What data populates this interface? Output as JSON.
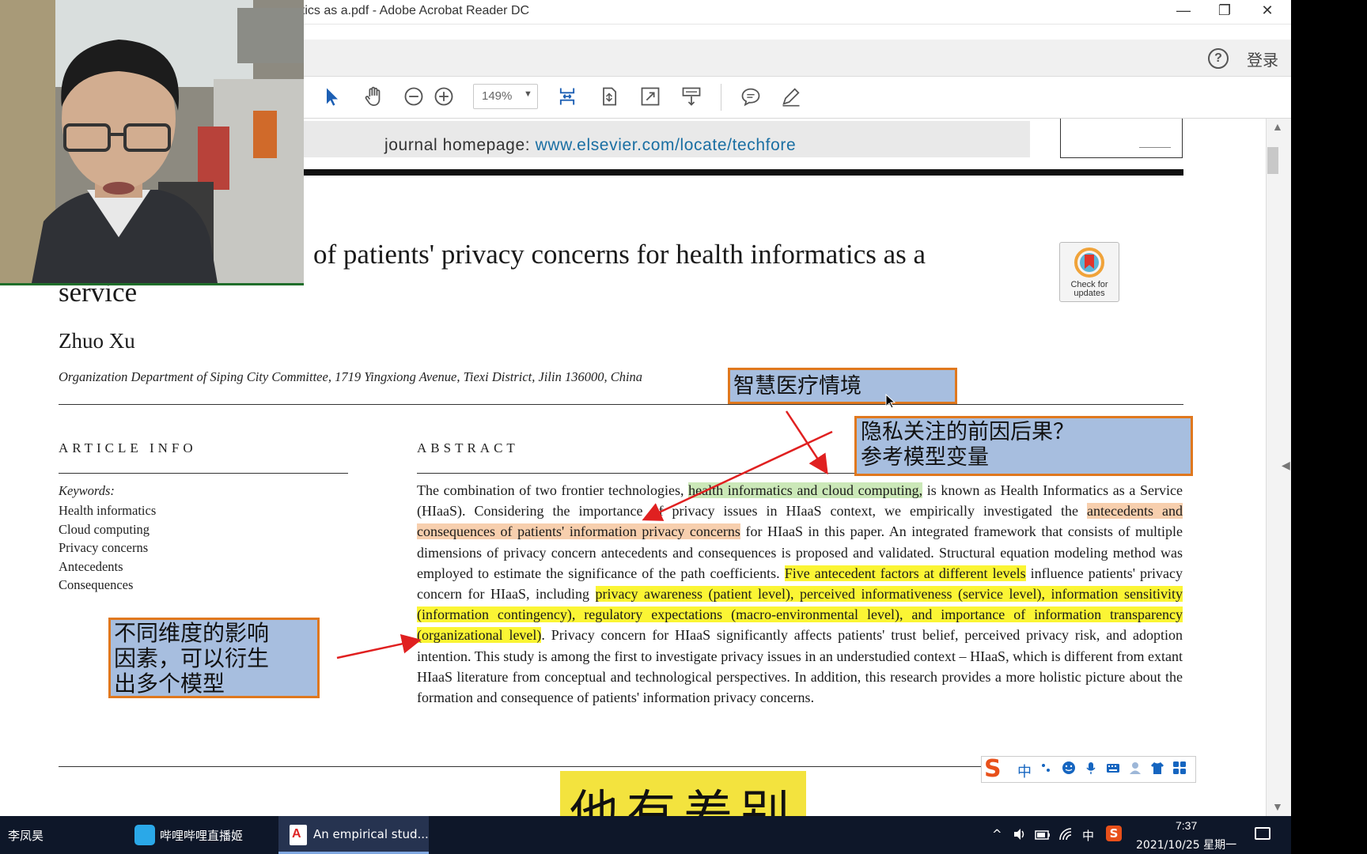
{
  "window": {
    "title": "atics as a.pdf - Adobe Acrobat Reader DC",
    "minimize_icon": "—",
    "restore_icon": "❐",
    "close_icon": "✕"
  },
  "menubar": {
    "help_icon": "?",
    "login_label": "登录"
  },
  "toolbar": {
    "zoom_value": "149%",
    "zoom_caret": "▼"
  },
  "document": {
    "journal_prefix": "journal homepage: ",
    "journal_url": "www.elsevier.com/locate/techfore",
    "title_line1": "of patients' privacy concerns for health informatics as a",
    "title_line2": "service",
    "check_badge_label": "Check for updates",
    "author": "Zhuo Xu",
    "affiliation": "Organization Department of Siping City Committee, 1719 Yingxiong Avenue, Tiexi District, Jilin 136000, China",
    "article_info_heading": "ARTICLE INFO",
    "keywords_label": "Keywords:",
    "keywords": [
      "Health informatics",
      "Cloud computing",
      "Privacy concerns",
      "Antecedents",
      "Consequences"
    ],
    "abstract_heading": "ABSTRACT",
    "abstract": {
      "p1": "The combination of two frontier technologies, ",
      "h1": "health informatics and cloud computing,",
      "p2": " is known as Health Informatics as a Service (HIaaS). Considering the importance of privacy issues in HIaaS context, we empirically investigated the ",
      "h2": "antecedents and consequences of patients' information privacy concerns",
      "p3": " for HIaaS in this paper. An integrated framework that consists of multiple dimensions of privacy concern antecedents and consequences is proposed and validated. Structural equation modeling method was employed to estimate the significance of the path coefficients. ",
      "h3": "Five antecedent factors at different levels",
      "p4": " influence patients' privacy concern for HIaaS, including ",
      "h4": "privacy awareness (patient level), perceived informativeness (service level), information sensitivity (information contingency), regulatory expectations (macro-environmental level), and importance of information transparency (organizational level)",
      "p5": ". Privacy concern for HIaaS significantly affects patients' trust belief, perceived privacy risk, and adoption intention. This study is among the first to investigate privacy issues in an understudied context – HIaaS, which is different from extant HIaaS literature from conceptual and technological perspectives. In addition, this research provides a more holistic picture about the formation and consequence of patients' information privacy concerns."
    }
  },
  "annotations": {
    "scene": "智慧医疗情境",
    "privacy_line1": "隐私关注的前因后果？",
    "privacy_line2": "参考模型变量",
    "dimensions_line1": "不同维度的影响",
    "dimensions_line2": "因素，可以衍生",
    "dimensions_line3": "出多个模型"
  },
  "subtitle": "他有差别",
  "ime": {
    "logo": "S",
    "lang": "中"
  },
  "taskbar": {
    "user": "李凤昊",
    "apps": [
      {
        "label": "哔哩哔哩直播姬"
      },
      {
        "label": "An empirical stud..."
      }
    ],
    "tray_caret": "^",
    "tray_lang": "中",
    "time": "7:37",
    "date": "2021/10/25 星期一"
  },
  "colors": {
    "highlight_green": "#cbe8b8",
    "highlight_orange": "#f7cfae",
    "highlight_yellow": "#fbf534",
    "note_fill": "#a7bedf",
    "note_border": "#e0781e",
    "arrow": "#e02020",
    "link": "#1a6fa3"
  }
}
